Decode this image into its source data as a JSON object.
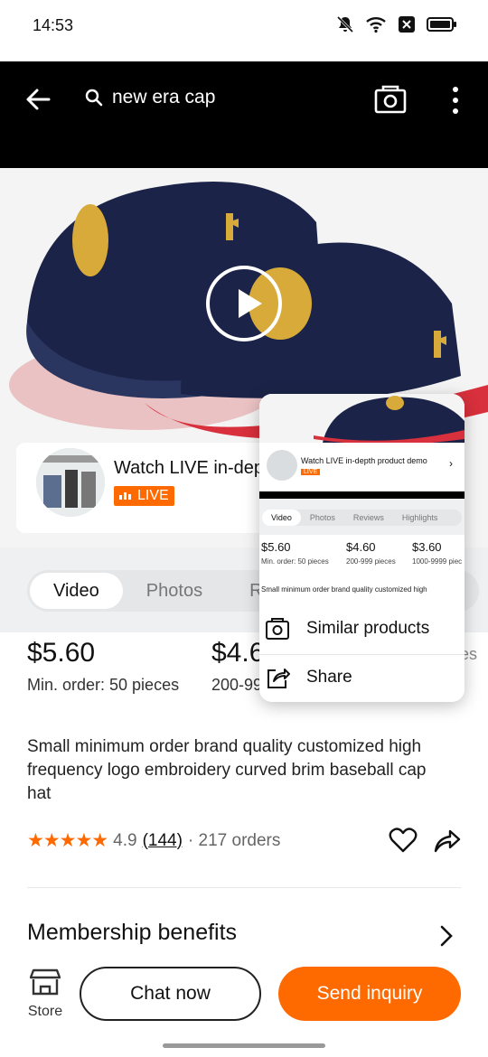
{
  "status_bar": {
    "time": "14:53"
  },
  "search": {
    "query": "new era cap"
  },
  "live": {
    "title": "Watch LIVE in-depth product demo",
    "title_visible": "Watch LIVE in-dept",
    "badge": "LIVE"
  },
  "tabs": [
    {
      "label": "Video",
      "active": true
    },
    {
      "label": "Photos",
      "active": false
    },
    {
      "label": "Re",
      "active": false
    }
  ],
  "prices": [
    {
      "value": "$5.60",
      "note": "Min. order: 50 pieces"
    },
    {
      "value": "$4.6",
      "note": "200-999"
    },
    {
      "value": "",
      "note": "ces"
    }
  ],
  "product": {
    "title": "Small minimum order brand quality customized high frequency logo embroidery curved brim baseball cap hat",
    "rating": "4.9",
    "reviews": "(144)",
    "orders": "· 217 orders"
  },
  "membership": {
    "label": "Membership benefits"
  },
  "bottom": {
    "store": "Store",
    "chat": "Chat now",
    "inquiry": "Send inquiry"
  },
  "popup": {
    "live_title": "Watch LIVE in-depth product demo",
    "live_badge": "LIVE",
    "tabs": [
      "Video",
      "Photos",
      "Reviews",
      "Highlights"
    ],
    "prices": [
      {
        "value": "$5.60",
        "note": "Min. order: 50 pieces"
      },
      {
        "value": "$4.60",
        "note": "200-999 pieces"
      },
      {
        "value": "$3.60",
        "note": "1000-9999 piec"
      }
    ],
    "desc": "Small minimum order brand quality customized high",
    "menu": [
      {
        "label": "Similar products",
        "icon": "camera-search-icon"
      },
      {
        "label": "Share",
        "icon": "share-icon"
      }
    ]
  },
  "colors": {
    "accent": "#ff6a00",
    "dark": "#000000",
    "cap": "#1b2448",
    "gold": "#d7aa3a",
    "red_underbrim": "#d8303c"
  }
}
